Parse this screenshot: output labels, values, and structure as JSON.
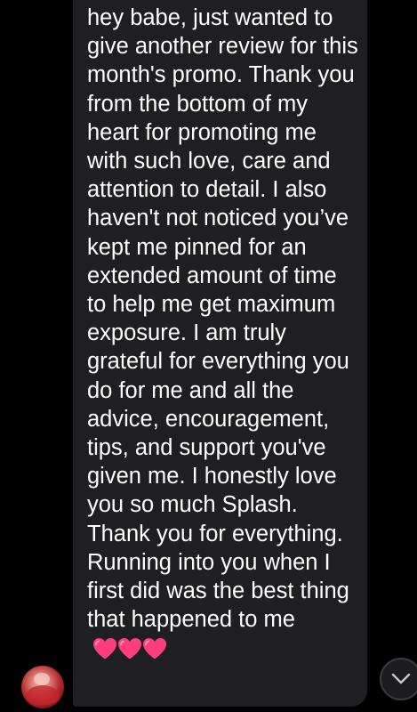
{
  "message": {
    "text": "hey babe, just wanted to give another review for this month's promo. Thank you from the bottom of my heart for promoting me with such love, care and attention to detail. I also haven't not noticed you’ve kept me pinned for an extended amount of time to help me get maximum exposure. I am truly grateful for everything you do for me and all the advice, encouragement, tips, and support you've given me. I honestly love you so much Splash. Thank you for everything. Running into you when I first did was the best thing that happened to me",
    "emoji": [
      "pink-heart-icon",
      "pink-heart-icon",
      "pink-heart-icon"
    ],
    "bubble_color": "#1f1f21",
    "text_color": "#ffffff"
  },
  "sender": {
    "avatar_icon": "avatar"
  },
  "scroll_button": {
    "icon": "chevron-down-icon"
  },
  "colors": {
    "background": "#000000",
    "heart": "#ff3d7f"
  }
}
